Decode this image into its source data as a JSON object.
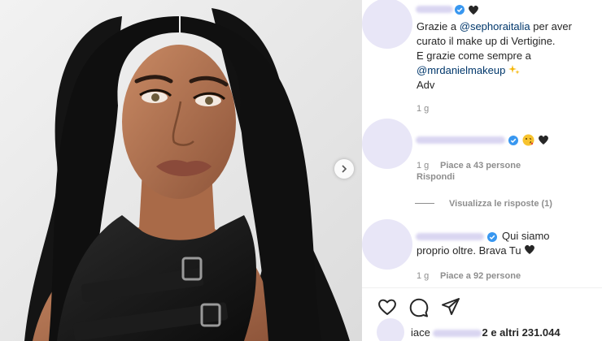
{
  "post": {
    "photo_alt": "",
    "next_button": "next"
  },
  "comments": [
    {
      "username": "",
      "verified": true,
      "lines": [
        {
          "parts": [
            {
              "t": "Grazie a ",
              "mention": false
            },
            {
              "t": "@sephoraitalia",
              "mention": true
            },
            {
              "t": " per aver",
              "mention": false
            }
          ]
        },
        {
          "parts": [
            {
              "t": "curato il make up di Vertigine.",
              "mention": false
            }
          ]
        },
        {
          "parts": [
            {
              "t": "E grazie come sempre a",
              "mention": false
            }
          ]
        },
        {
          "parts": [
            {
              "t": "@mrdanielmakeup",
              "mention": true
            }
          ]
        },
        {
          "parts": [
            {
              "t": "Adv",
              "mention": false
            }
          ]
        }
      ],
      "time": "1 g"
    },
    {
      "username": "",
      "verified": true,
      "time": "1 g",
      "likes": "Piace a 43 persone",
      "reply": "Rispondi",
      "view_replies": "Visualizza le risposte (1)"
    },
    {
      "username": "",
      "verified": true,
      "text_line1": "Qui siamo",
      "text_line2": "proprio oltre. Brava Tu",
      "time": "1 g",
      "likes": "Piace a 92 persone"
    }
  ],
  "actions": {
    "like_icon": "heart-icon",
    "comment_icon": "comment-icon",
    "share_icon": "paper-plane-icon"
  },
  "likes_summary": {
    "prefix": "iace",
    "suffix": "2 e altri 231.044"
  },
  "colors": {
    "mention": "#00376b",
    "verified": "#3897f0",
    "muted": "#8e8e8e",
    "placeholder": "#e8e6f7"
  }
}
